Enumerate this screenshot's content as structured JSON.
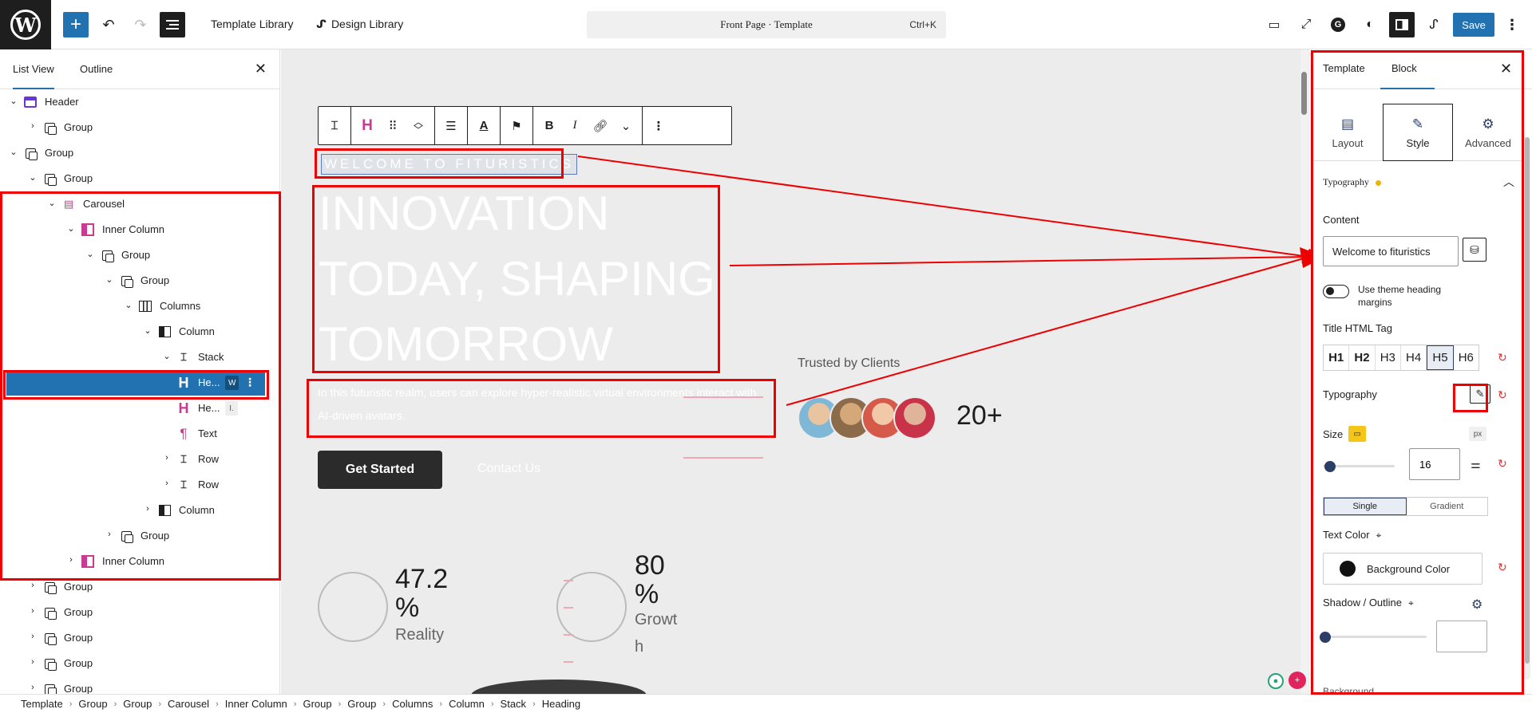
{
  "topbar": {
    "logo_text": "W",
    "template_library": "Template Library",
    "design_library": "Design Library",
    "command_title": "Front Page · Template",
    "command_shortcut": "Ctrl+K",
    "save_label": "Save",
    "accent_color": "#2271b1"
  },
  "left_panel": {
    "tabs": [
      "List View",
      "Outline"
    ],
    "tree": [
      {
        "label": "Header",
        "icon": "header-icon"
      },
      {
        "label": "Group",
        "icon": "group-icon"
      },
      {
        "label": "Group",
        "icon": "group-icon"
      },
      {
        "label": "Group",
        "icon": "group-icon"
      },
      {
        "label": "Carousel",
        "icon": "carousel-icon"
      },
      {
        "label": "Inner Column",
        "icon": "inner-column-icon"
      },
      {
        "label": "Group",
        "icon": "group-icon"
      },
      {
        "label": "Group",
        "icon": "group-icon"
      },
      {
        "label": "Columns",
        "icon": "columns-icon"
      },
      {
        "label": "Column",
        "icon": "column-icon"
      },
      {
        "label": "Stack",
        "icon": "stack-icon"
      },
      {
        "label": "He...",
        "icon": "heading-icon",
        "badge": "W"
      },
      {
        "label": "He...",
        "icon": "heading-icon",
        "badge": "I."
      },
      {
        "label": "Text",
        "icon": "paragraph-icon"
      },
      {
        "label": "Row",
        "icon": "row-icon"
      },
      {
        "label": "Row",
        "icon": "row-icon"
      },
      {
        "label": "Column",
        "icon": "column-icon"
      },
      {
        "label": "Group",
        "icon": "group-icon"
      },
      {
        "label": "Inner Column",
        "icon": "inner-column-icon"
      },
      {
        "label": "Group",
        "icon": "group-icon"
      },
      {
        "label": "Group",
        "icon": "group-icon"
      },
      {
        "label": "Group",
        "icon": "group-icon"
      },
      {
        "label": "Group",
        "icon": "group-icon"
      },
      {
        "label": "Group",
        "icon": "group-icon"
      }
    ]
  },
  "canvas": {
    "eyebrow": "WELCOME TO FITURISTICS",
    "hero_lines": [
      "INNOVATION",
      "TODAY, SHAPING",
      "TOMORROW"
    ],
    "paragraph": "In this futuristic realm, users can explore hyper-realistic virtual environments interact with AI-driven avatars.",
    "get_started": "Get Started",
    "contact_us": "Contact Us",
    "trusted": "Trusted by Clients",
    "clients_count": "20+",
    "stats": [
      {
        "number": "47.2 %",
        "label": "Reality"
      },
      {
        "number": "80 %",
        "label": "Growth"
      }
    ]
  },
  "breadcrumb": [
    "Template",
    "Group",
    "Group",
    "Carousel",
    "Inner Column",
    "Group",
    "Group",
    "Columns",
    "Column",
    "Stack",
    "Heading"
  ],
  "inspector": {
    "tabs": [
      "Template",
      "Block"
    ],
    "modes": [
      "Layout",
      "Style",
      "Advanced"
    ],
    "typography_section": "Typography",
    "content_label": "Content",
    "content_value": "Welcome to fituristics",
    "theme_margins_label": "Use theme heading margins",
    "title_tag_label": "Title HTML Tag",
    "title_tags": [
      "H1",
      "H2",
      "H3",
      "H4",
      "H5",
      "H6"
    ],
    "selected_tag": "H5",
    "typography_label": "Typography",
    "size_label": "Size",
    "size_unit": "px",
    "size_value": "16",
    "fill_modes": [
      "Single",
      "Gradient"
    ],
    "text_color_label": "Text Color",
    "background_color_btn": "Background Color",
    "shadow_label": "Shadow / Outline",
    "cutoff_label": "Background"
  }
}
